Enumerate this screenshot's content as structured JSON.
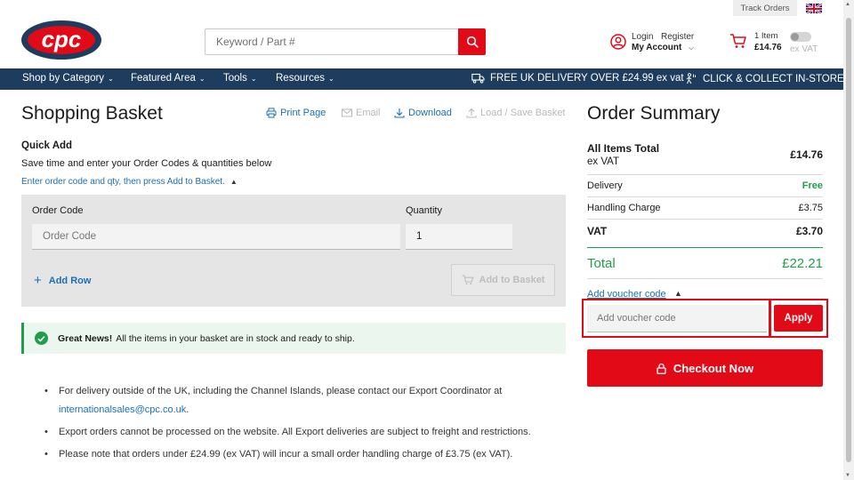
{
  "topbar": {
    "track_orders": "Track Orders"
  },
  "header": {
    "logo_text": "cpc",
    "search_placeholder": "Keyword / Part #",
    "account": {
      "login": "Login",
      "register": "Register",
      "my_account": "My Account"
    },
    "cart": {
      "items": "1 Item",
      "price": "£14.76"
    },
    "vat_label": "ex VAT"
  },
  "nav": {
    "items": [
      {
        "label": "Shop by Category"
      },
      {
        "label": "Featured Area"
      },
      {
        "label": "Tools"
      },
      {
        "label": "Resources"
      }
    ],
    "promo_delivery": "FREE UK DELIVERY OVER £24.99 ex vat",
    "promo_collect": "CLICK & COLLECT IN-STORE"
  },
  "basket": {
    "title": "Shopping Basket",
    "tools": {
      "print": "Print Page",
      "email": "Email",
      "download": "Download",
      "load_save": "Load / Save Basket"
    },
    "quick_add": {
      "title": "Quick Add",
      "subtitle": "Save time and enter your Order Codes & quantities below",
      "hint": "Enter order code and qty, then press Add to Basket.",
      "order_code_label": "Order Code",
      "order_code_placeholder": "Order Code",
      "quantity_label": "Quantity",
      "quantity_value": "1",
      "add_row": "Add Row",
      "add_to_basket": "Add to Basket"
    },
    "great_news": {
      "bold": "Great News!",
      "text": "All the items in your basket are in stock and ready to ship."
    },
    "notes": {
      "n1_text": "For delivery outside of the UK, including the Channel Islands, please contact our Export Coordinator at",
      "n1_link": "internationalsales@cpc.co.uk",
      "n1_end": ".",
      "n2": "Export orders cannot be processed on the website. All Export deliveries are subject to freight and restrictions.",
      "n3": "Please note that orders under £24.99 (ex VAT) will incur a small order handling charge of £3.75 (ex VAT)."
    }
  },
  "summary": {
    "title": "Order Summary",
    "all_items_label": "All Items Total",
    "all_items_sub": "ex VAT",
    "all_items_value": "£14.76",
    "delivery_label": "Delivery",
    "delivery_value": "Free",
    "handling_label": "Handling Charge",
    "handling_value": "£3.75",
    "vat_label": "VAT",
    "vat_value": "£3.70",
    "total_label": "Total",
    "total_value": "£22.21",
    "voucher_link": "Add voucher code",
    "voucher_placeholder": "Add voucher code",
    "apply": "Apply",
    "checkout": "Checkout Now"
  },
  "colors": {
    "brand_red": "#e30a17",
    "nav_blue": "#1d3c5e",
    "link_blue": "#1a6fb5",
    "success_green": "#1e9e4a"
  }
}
